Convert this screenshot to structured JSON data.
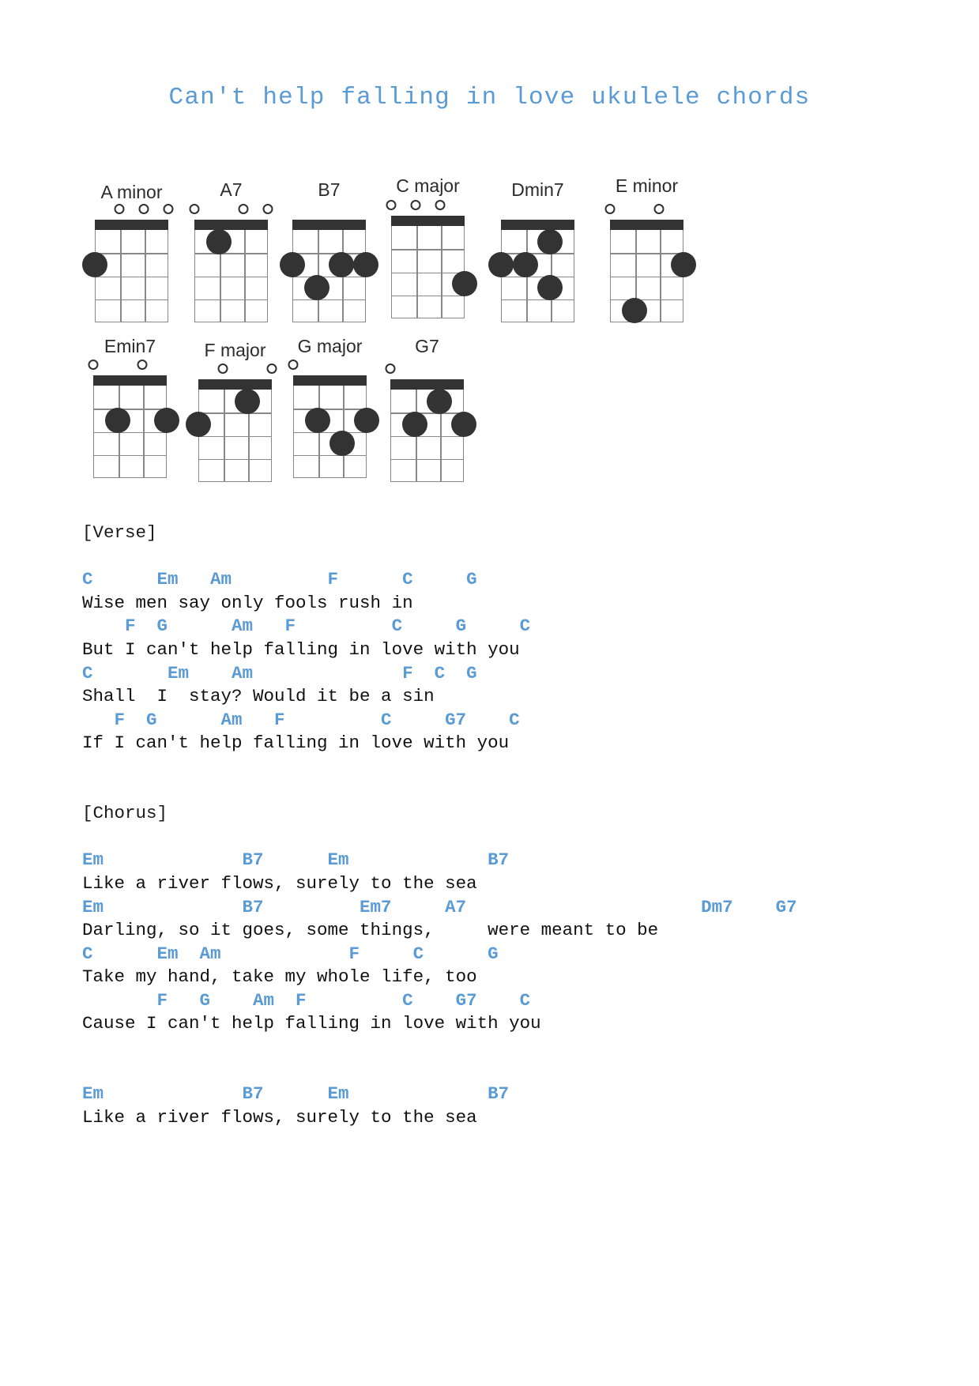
{
  "title": "Can't help falling in love ukulele chords",
  "colors": {
    "chord_blue": "#5b9bd5",
    "diagram_dark": "#333333",
    "diagram_grid": "#888888",
    "lyric_text": "#111111"
  },
  "chord_diagrams": {
    "instrument": "ukulele",
    "strings": 4,
    "frets": 4,
    "row1": [
      {
        "name": "A minor",
        "open_strings": [
          2,
          3,
          4
        ],
        "dots": [
          {
            "string": 1,
            "fret": 2
          }
        ]
      },
      {
        "name": "A7",
        "open_strings": [
          1,
          3,
          4
        ],
        "dots": [
          {
            "string": 2,
            "fret": 1
          }
        ]
      },
      {
        "name": "B7",
        "open_strings": [],
        "dots": [
          {
            "string": 1,
            "fret": 2
          },
          {
            "string": 3,
            "fret": 2
          },
          {
            "string": 4,
            "fret": 2
          },
          {
            "string": 2,
            "fret": 3
          }
        ]
      },
      {
        "name": "C major",
        "open_strings": [
          1,
          2,
          3
        ],
        "dots": [
          {
            "string": 4,
            "fret": 3
          }
        ]
      },
      {
        "name": "Dmin7",
        "open_strings": [],
        "dots": [
          {
            "string": 3,
            "fret": 1
          },
          {
            "string": 1,
            "fret": 2
          },
          {
            "string": 2,
            "fret": 2
          },
          {
            "string": 3,
            "fret": 3
          }
        ]
      },
      {
        "name": "E minor",
        "open_strings": [
          1,
          3
        ],
        "dots": [
          {
            "string": 4,
            "fret": 2
          },
          {
            "string": 2,
            "fret": 4
          }
        ]
      }
    ],
    "row2": [
      {
        "name": "Emin7",
        "open_strings": [
          1,
          3
        ],
        "dots": [
          {
            "string": 2,
            "fret": 2
          },
          {
            "string": 4,
            "fret": 2
          }
        ]
      },
      {
        "name": "F major",
        "open_strings": [
          2,
          4
        ],
        "dots": [
          {
            "string": 3,
            "fret": 1
          },
          {
            "string": 1,
            "fret": 2
          }
        ]
      },
      {
        "name": "G major",
        "open_strings": [
          1
        ],
        "dots": [
          {
            "string": 2,
            "fret": 2
          },
          {
            "string": 4,
            "fret": 2
          },
          {
            "string": 3,
            "fret": 3
          }
        ]
      },
      {
        "name": "G7",
        "open_strings": [
          1
        ],
        "dots": [
          {
            "string": 3,
            "fret": 1
          },
          {
            "string": 2,
            "fret": 2
          },
          {
            "string": 4,
            "fret": 2
          }
        ]
      }
    ]
  },
  "song": {
    "sections": [
      {
        "label": "[Verse]",
        "lines": [
          {
            "chords": "C      Em   Am         F      C     G",
            "lyric": "Wise men say only fools rush in"
          },
          {
            "chords": "    F  G      Am   F         C     G     C",
            "lyric": "But I can't help falling in love with you"
          },
          {
            "chords": "C       Em    Am              F  C  G",
            "lyric": "Shall  I  stay? Would it be a sin"
          },
          {
            "chords": "   F  G      Am   F         C     G7    C",
            "lyric": "If I can't help falling in love with you"
          }
        ]
      },
      {
        "label": "[Chorus]",
        "lines": [
          {
            "chords": "Em             B7      Em             B7",
            "lyric": "Like a river flows, surely to the sea"
          },
          {
            "chords": "Em             B7         Em7     A7                      Dm7    G7",
            "lyric": "Darling, so it goes, some things,     were meant to be"
          },
          {
            "chords": "C      Em  Am            F     C      G",
            "lyric": "Take my hand, take my whole life, too"
          },
          {
            "chords": "       F   G    Am  F         C    G7    C",
            "lyric": "Cause I can't help falling in love with you"
          }
        ]
      },
      {
        "label": "",
        "lines": [
          {
            "chords": "Em             B7      Em             B7",
            "lyric": "Like a river flows, surely to the sea"
          }
        ]
      }
    ]
  }
}
